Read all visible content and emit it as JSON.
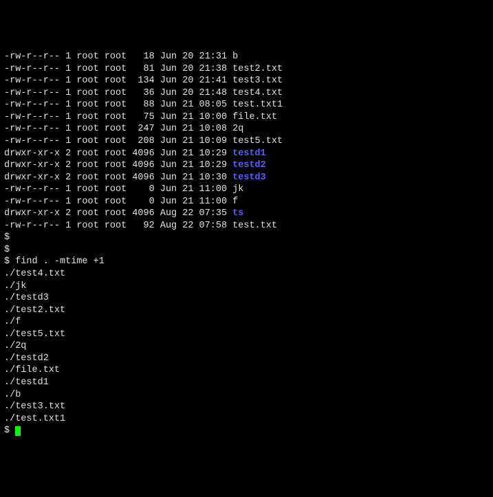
{
  "listing": [
    {
      "perm": "-rw-r--r--",
      "links": "1",
      "owner": "root",
      "group": "root",
      "size": "18",
      "month": "Jun",
      "day": "20",
      "time": "21:31",
      "name": "b",
      "type": "file"
    },
    {
      "perm": "-rw-r--r--",
      "links": "1",
      "owner": "root",
      "group": "root",
      "size": "81",
      "month": "Jun",
      "day": "20",
      "time": "21:38",
      "name": "test2.txt",
      "type": "file"
    },
    {
      "perm": "-rw-r--r--",
      "links": "1",
      "owner": "root",
      "group": "root",
      "size": "134",
      "month": "Jun",
      "day": "20",
      "time": "21:41",
      "name": "test3.txt",
      "type": "file"
    },
    {
      "perm": "-rw-r--r--",
      "links": "1",
      "owner": "root",
      "group": "root",
      "size": "36",
      "month": "Jun",
      "day": "20",
      "time": "21:48",
      "name": "test4.txt",
      "type": "file"
    },
    {
      "perm": "-rw-r--r--",
      "links": "1",
      "owner": "root",
      "group": "root",
      "size": "88",
      "month": "Jun",
      "day": "21",
      "time": "08:05",
      "name": "test.txt1",
      "type": "file"
    },
    {
      "perm": "-rw-r--r--",
      "links": "1",
      "owner": "root",
      "group": "root",
      "size": "75",
      "month": "Jun",
      "day": "21",
      "time": "10:00",
      "name": "file.txt",
      "type": "file"
    },
    {
      "perm": "-rw-r--r--",
      "links": "1",
      "owner": "root",
      "group": "root",
      "size": "247",
      "month": "Jun",
      "day": "21",
      "time": "10:08",
      "name": "2q",
      "type": "file"
    },
    {
      "perm": "-rw-r--r--",
      "links": "1",
      "owner": "root",
      "group": "root",
      "size": "208",
      "month": "Jun",
      "day": "21",
      "time": "10:09",
      "name": "test5.txt",
      "type": "file"
    },
    {
      "perm": "drwxr-xr-x",
      "links": "2",
      "owner": "root",
      "group": "root",
      "size": "4096",
      "month": "Jun",
      "day": "21",
      "time": "10:29",
      "name": "testd1",
      "type": "dir"
    },
    {
      "perm": "drwxr-xr-x",
      "links": "2",
      "owner": "root",
      "group": "root",
      "size": "4096",
      "month": "Jun",
      "day": "21",
      "time": "10:29",
      "name": "testd2",
      "type": "dir"
    },
    {
      "perm": "drwxr-xr-x",
      "links": "2",
      "owner": "root",
      "group": "root",
      "size": "4096",
      "month": "Jun",
      "day": "21",
      "time": "10:30",
      "name": "testd3",
      "type": "dir"
    },
    {
      "perm": "-rw-r--r--",
      "links": "1",
      "owner": "root",
      "group": "root",
      "size": "0",
      "month": "Jun",
      "day": "21",
      "time": "11:00",
      "name": "jk",
      "type": "file"
    },
    {
      "perm": "-rw-r--r--",
      "links": "1",
      "owner": "root",
      "group": "root",
      "size": "0",
      "month": "Jun",
      "day": "21",
      "time": "11:00",
      "name": "f",
      "type": "file"
    },
    {
      "perm": "drwxr-xr-x",
      "links": "2",
      "owner": "root",
      "group": "root",
      "size": "4096",
      "month": "Aug",
      "day": "22",
      "time": "07:35",
      "name": "ts",
      "type": "dir"
    },
    {
      "perm": "-rw-r--r--",
      "links": "1",
      "owner": "root",
      "group": "root",
      "size": "92",
      "month": "Aug",
      "day": "22",
      "time": "07:58",
      "name": "test.txt",
      "type": "file"
    }
  ],
  "prompts": {
    "ps": "$",
    "empty1": "$",
    "empty2": "$",
    "cmd_prefix": "$ ",
    "command": "find . -mtime +1",
    "final": "$ "
  },
  "find_output": [
    "./test4.txt",
    "./jk",
    "./testd3",
    "./test2.txt",
    "./f",
    "./test5.txt",
    "./2q",
    "./testd2",
    "./file.txt",
    "./testd1",
    "./b",
    "./test3.txt",
    "./test.txt1"
  ]
}
